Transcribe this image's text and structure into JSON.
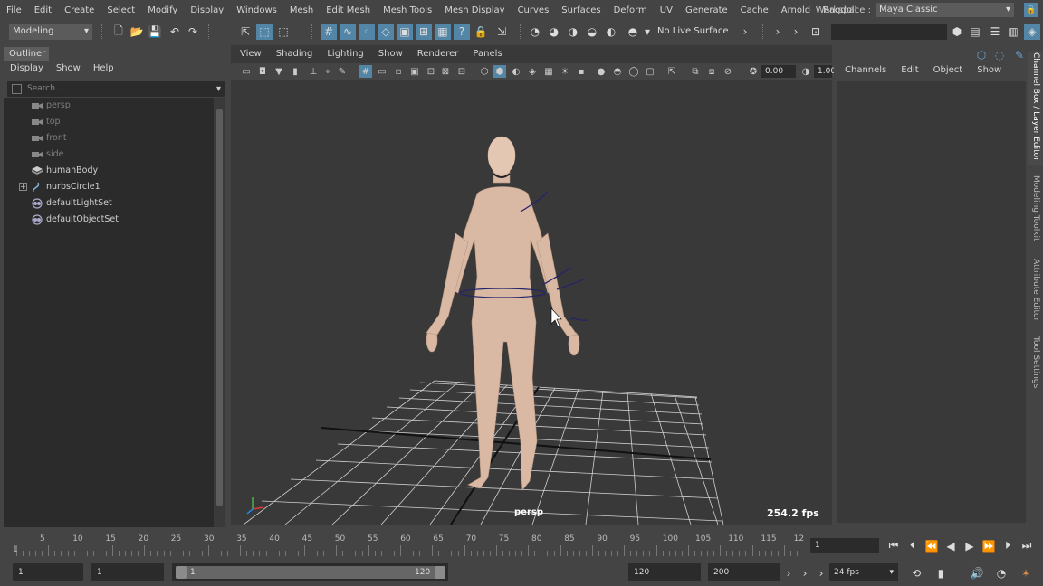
{
  "menu": [
    "File",
    "Edit",
    "Create",
    "Select",
    "Modify",
    "Display",
    "Windows",
    "Mesh",
    "Edit Mesh",
    "Mesh Tools",
    "Mesh Display",
    "Curves",
    "Surfaces",
    "Deform",
    "UV",
    "Generate",
    "Cache",
    "Arnold",
    "Ragdoll"
  ],
  "workspace": {
    "label": "Workspace :",
    "value": "Maya Classic"
  },
  "statusline": {
    "mode": "Modeling",
    "live_surface": "No Live Surface"
  },
  "outliner": {
    "title": "Outliner",
    "menu": [
      "Display",
      "Show",
      "Help"
    ],
    "search_placeholder": "Search...",
    "items": [
      {
        "label": "persp",
        "icon": "camera-icon",
        "dim": true
      },
      {
        "label": "top",
        "icon": "camera-icon",
        "dim": true
      },
      {
        "label": "front",
        "icon": "camera-icon",
        "dim": true
      },
      {
        "label": "side",
        "icon": "camera-icon",
        "dim": true
      },
      {
        "label": "humanBody",
        "icon": "mesh-icon",
        "dim": false
      },
      {
        "label": "nurbsCircle1",
        "icon": "curve-icon",
        "dim": false
      },
      {
        "label": "defaultLightSet",
        "icon": "set-icon",
        "dim": false
      },
      {
        "label": "defaultObjectSet",
        "icon": "set-icon",
        "dim": false
      }
    ]
  },
  "viewport": {
    "menu": [
      "View",
      "Shading",
      "Lighting",
      "Show",
      "Renderer",
      "Panels"
    ],
    "exposure": "0.00",
    "gamma": "1.00",
    "camera": "persp",
    "fps": "254.2 fps"
  },
  "channelbox": {
    "menu": [
      "Channels",
      "Edit",
      "Object",
      "Show"
    ],
    "side_tabs": [
      "Channel Box / Layer Editor",
      "Modeling Toolkit",
      "Attribute Editor",
      "Tool Settings"
    ]
  },
  "timeslider": {
    "ticks": [
      "1",
      "5",
      "10",
      "15",
      "20",
      "25",
      "30",
      "35",
      "40",
      "45",
      "50",
      "55",
      "60",
      "65",
      "70",
      "75",
      "80",
      "85",
      "90",
      "95",
      "100",
      "105",
      "110",
      "115",
      "12"
    ],
    "current_frame": "1"
  },
  "rangeslider": {
    "start": "1",
    "range_start": "1",
    "bar_start": "1",
    "bar_end": "120",
    "end": "120",
    "anim_end": "200",
    "fps": "24 fps"
  },
  "colors": {
    "accent": "#5285a6",
    "panel": "#444444",
    "field": "#2b2b2b",
    "viewport_bg": "#393939",
    "skin": "#d9b9a3"
  }
}
